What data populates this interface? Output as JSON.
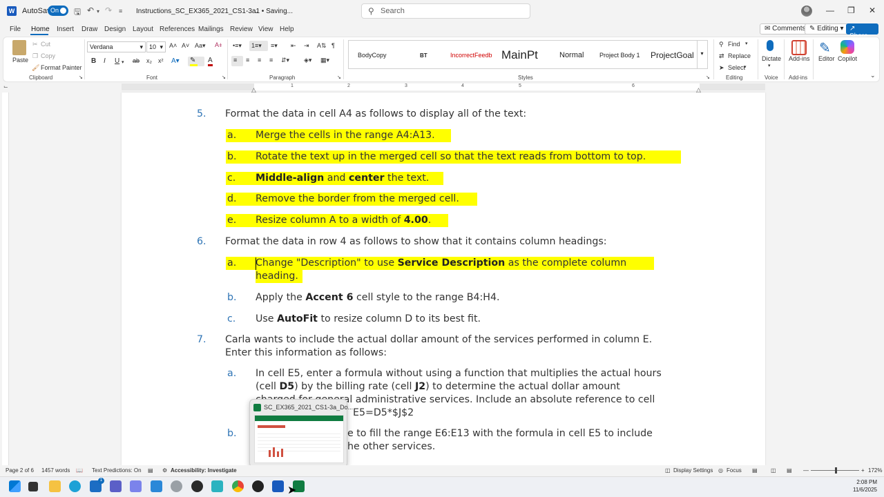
{
  "titlebar": {
    "autosave_label": "AutoSave",
    "autosave_state": "On",
    "doc_title": "Instructions_SC_EX365_2021_CS1-3a1 • Saving...",
    "search_placeholder": "Search"
  },
  "menu": {
    "tabs": [
      "File",
      "Home",
      "Insert",
      "Draw",
      "Design",
      "Layout",
      "References",
      "Mailings",
      "Review",
      "View",
      "Help"
    ],
    "active_tab": "Home",
    "comments": "Comments",
    "editing": "Editing",
    "share": "Share"
  },
  "ribbon": {
    "clipboard": {
      "paste": "Paste",
      "cut": "Cut",
      "copy": "Copy",
      "format_painter": "Format Painter",
      "label": "Clipboard"
    },
    "font": {
      "name": "Verdana",
      "size": "10",
      "label": "Font"
    },
    "paragraph": {
      "label": "Paragraph"
    },
    "styles": {
      "items": [
        "BodyCopy",
        "BT",
        "IncorrectFeedb",
        "MainPt",
        "Normal",
        "Project Body 1",
        "ProjectGoal"
      ],
      "label": "Styles"
    },
    "editing": {
      "find": "Find",
      "replace": "Replace",
      "select": "Select",
      "label": "Editing"
    },
    "voice": {
      "dictate": "Dictate",
      "label": "Voice"
    },
    "addins": {
      "addins": "Add-ins",
      "label": "Add-ins"
    },
    "editor": "Editor",
    "copilot": "Copilot"
  },
  "ruler": [
    "1",
    "2",
    "3",
    "4",
    "5",
    "6"
  ],
  "document": {
    "item5": {
      "num": "5.",
      "text": "Format the data in cell A4 as follows to display all of the text:"
    },
    "item5a": {
      "letter": "a.",
      "text": "Merge the cells in the range A4:A13."
    },
    "item5b": {
      "letter": "b.",
      "text": "Rotate the text up in the merged cell so that the text reads from bottom to top."
    },
    "item5c": {
      "letter": "c.",
      "b1": "Middle-align",
      "t1": " and ",
      "b2": "center",
      "t2": " the text."
    },
    "item5d": {
      "letter": "d.",
      "text": "Remove the border from the merged cell."
    },
    "item5e": {
      "letter": "e.",
      "t1": "Resize column A to a width of ",
      "b1": "4.00",
      "t2": "."
    },
    "item6": {
      "num": "6.",
      "text": "Format the data in row 4 as follows to show that it contains column headings:"
    },
    "item6a": {
      "letter": "a.",
      "t1": "Change \"Description\" to use ",
      "b1": "Service Description",
      "t2": " as the complete column",
      "line2": "heading."
    },
    "item6b": {
      "letter": "b.",
      "t1": "Apply the ",
      "b1": "Accent 6",
      "t2": " cell style to the range B4:H4."
    },
    "item6c": {
      "letter": "c.",
      "t1": "Use ",
      "b1": "AutoFit",
      "t2": " to resize column D to its best fit."
    },
    "item7": {
      "num": "7.",
      "line1": "Carla wants to include the actual dollar amount of the services performed in column E.",
      "line2": "Enter this information as follows:"
    },
    "item7a": {
      "letter": "a.",
      "line1": "In cell E5, enter a formula without using a function that multiplies the actual hours",
      "l2_t1": "(cell ",
      "l2_b1": "D5",
      "l2_t2": ") by the billing rate (cell ",
      "l2_b2": "J2",
      "l2_t3": ") to determine the actual dollar amount",
      "line3_visible": "charged for general administrative services. Include an absolute reference to cell",
      "line4_visible": "E5=D5*$J$2"
    },
    "item7b": {
      "letter": "b.",
      "line1_visible": "e to fill the range E6:E13 with the formula in cell E5 to include",
      "line2_visible": "he other services."
    }
  },
  "thumbnail": {
    "title": "SC_EX365_2021_CS1-3a_Do..."
  },
  "status": {
    "page": "Page 2 of 6",
    "words": "1457 words",
    "text_predictions": "Text Predictions: On",
    "accessibility": "Accessibility: Investigate",
    "display_settings": "Display Settings",
    "focus": "Focus",
    "zoom": "172%"
  },
  "clock": {
    "time": "2:08 PM",
    "date": "11/6/2025"
  },
  "taskbar_badge": "1",
  "colors": {
    "accent": "#0f6cbd",
    "highlight": "#ffff00",
    "list_number": "#2e74b5"
  }
}
